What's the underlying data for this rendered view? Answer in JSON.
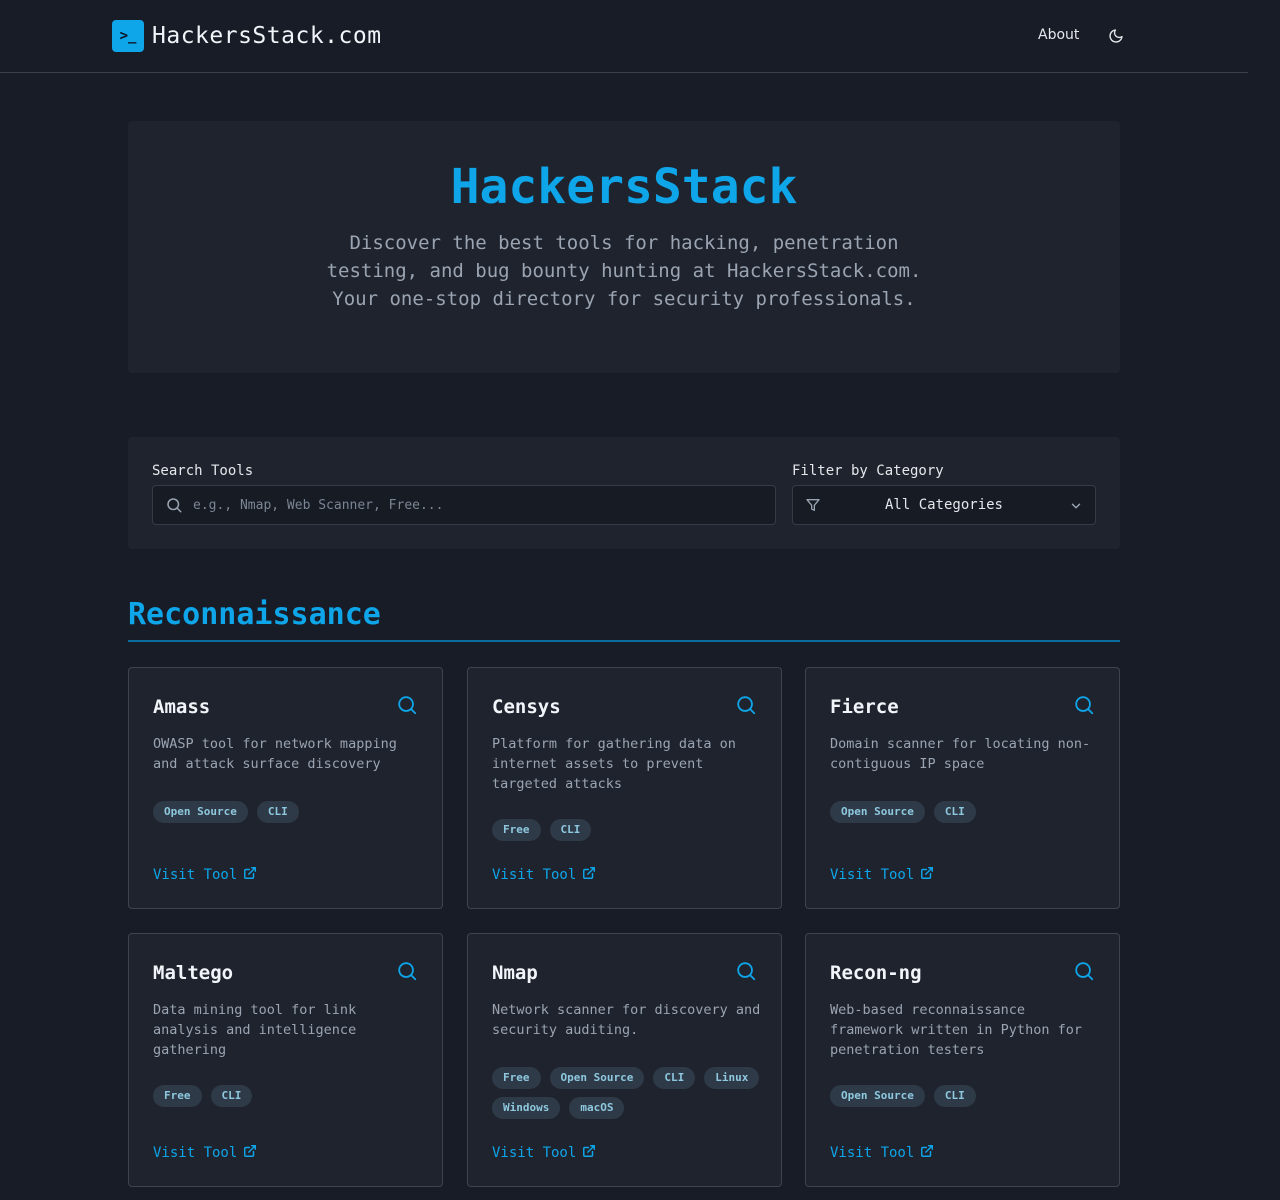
{
  "header": {
    "logo_glyph": ">_",
    "logo_text": "HackersStack.com",
    "about_label": "About",
    "theme_icon": "moon-icon"
  },
  "hero": {
    "title": "HackersStack",
    "description": "Discover the best tools for hacking, penetration testing, and bug bounty hunting at HackersStack.com. Your one-stop directory for security professionals."
  },
  "search": {
    "label": "Search Tools",
    "placeholder": "e.g., Nmap, Web Scanner, Free...",
    "value": ""
  },
  "filter": {
    "label": "Filter by Category",
    "selected": "All Categories"
  },
  "section": {
    "title": "Reconnaissance"
  },
  "colors": {
    "accent": "#0ea5e9",
    "background": "#171c26",
    "panel": "#1f232d",
    "tag_bg": "#2e3a47",
    "tag_text": "#8ec8df"
  },
  "visit_label": "Visit Tool",
  "tools": [
    {
      "name": "Amass",
      "description": "OWASP tool for network mapping and attack surface discovery",
      "tags": [
        "Open Source",
        "CLI"
      ]
    },
    {
      "name": "Censys",
      "description": "Platform for gathering data on internet assets to prevent targeted attacks",
      "tags": [
        "Free",
        "CLI"
      ]
    },
    {
      "name": "Fierce",
      "description": "Domain scanner for locating non-contiguous IP space",
      "tags": [
        "Open Source",
        "CLI"
      ]
    },
    {
      "name": "Maltego",
      "description": "Data mining tool for link analysis and intelligence gathering",
      "tags": [
        "Free",
        "CLI"
      ]
    },
    {
      "name": "Nmap",
      "description": "Network scanner for discovery and security auditing.",
      "tags": [
        "Free",
        "Open Source",
        "CLI",
        "Linux",
        "Windows",
        "macOS"
      ]
    },
    {
      "name": "Recon-ng",
      "description": "Web-based reconnaissance framework written in Python for penetration testers",
      "tags": [
        "Open Source",
        "CLI"
      ]
    }
  ]
}
